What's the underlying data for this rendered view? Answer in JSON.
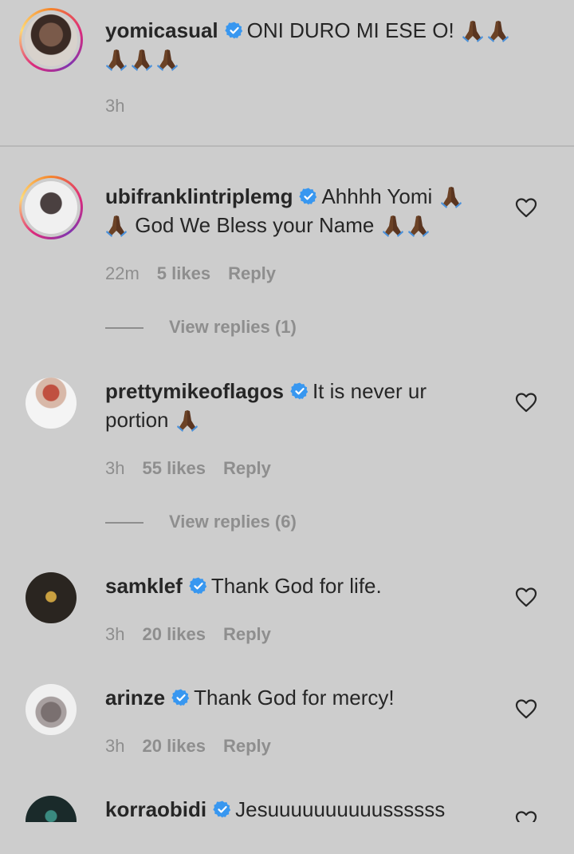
{
  "caption": {
    "username": "yomicasual",
    "text": "ONI DURO MI ESE O!",
    "time": "3h"
  },
  "comments": [
    {
      "username": "ubifranklintriplemg",
      "text_line1": "Ahhhh Yomi",
      "text_line2": "God We Bless your Name",
      "time": "22m",
      "likes": "5 likes",
      "reply": "Reply",
      "view_replies": "View replies (1)"
    },
    {
      "username": "prettymikeoflagos",
      "text_line1": "It is never ur",
      "text_line2": "portion",
      "time": "3h",
      "likes": "55 likes",
      "reply": "Reply",
      "view_replies": "View replies (6)"
    },
    {
      "username": "samklef",
      "text_line1": "Thank God for life.",
      "time": "3h",
      "likes": "20 likes",
      "reply": "Reply"
    },
    {
      "username": "arinze",
      "text_line1": "Thank God for mercy!",
      "time": "3h",
      "likes": "20 likes",
      "reply": "Reply"
    },
    {
      "username": "korraobidi",
      "text_line1": "Jesuuuuuuuuuussssss"
    }
  ],
  "icons": {
    "verified": "verified-badge-icon",
    "emoji": "folded-hands-emoji",
    "like": "heart-outline-icon"
  },
  "colors": {
    "background": "#cdcdcd",
    "verified": "#3897f0",
    "secondary_text": "#8e8e8e"
  }
}
